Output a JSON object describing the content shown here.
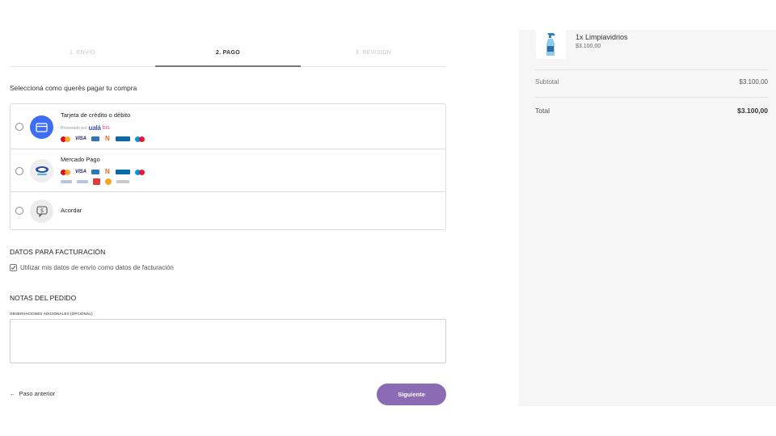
{
  "steps": [
    {
      "label": "1. ENVÍO",
      "state": "done"
    },
    {
      "label": "2. PAGO",
      "state": "active"
    },
    {
      "label": "3. REVISIÓN",
      "state": "pending"
    }
  ],
  "payment": {
    "question": "Seleccioná como querés pagar tu compra",
    "options": [
      {
        "title": "Tarjeta de crédito o débito",
        "processed_by": "Procesado por",
        "processor_logo": "ualá",
        "processor_suffix": "bis",
        "icon": "credit-card-icon"
      },
      {
        "title": "Mercado Pago",
        "icon": "mercado-pago-icon"
      },
      {
        "title": "Acordar",
        "icon": "chat-money-icon"
      }
    ],
    "card_logos": [
      "mastercard",
      "visa",
      "amex",
      "naranja",
      "cabal",
      "maestro"
    ],
    "visa_text": "VISA",
    "colors": {
      "card_icon_bg": "#3d6df2",
      "accent_button": "#8a6bb4"
    }
  },
  "billing": {
    "title": "DATOS PARA FACTURACIÓN",
    "checkbox_label": "Utilizar mis datos de envío como datos de facturación",
    "checked": true
  },
  "notes": {
    "title": "NOTAS DEL PEDIDO",
    "label": "OBSERVACIONES ADICIONALES (OPCIONAL)",
    "value": ""
  },
  "nav": {
    "prev_label": "Paso anterior",
    "next_label": "Siguiente"
  },
  "summary": {
    "product_name": "1x Limpiavidrios",
    "product_price": "$3.100,00",
    "subtotal_label": "Subtotal",
    "subtotal_value": "$3.100,00",
    "total_label": "Total",
    "total_value": "$3.100,00"
  }
}
